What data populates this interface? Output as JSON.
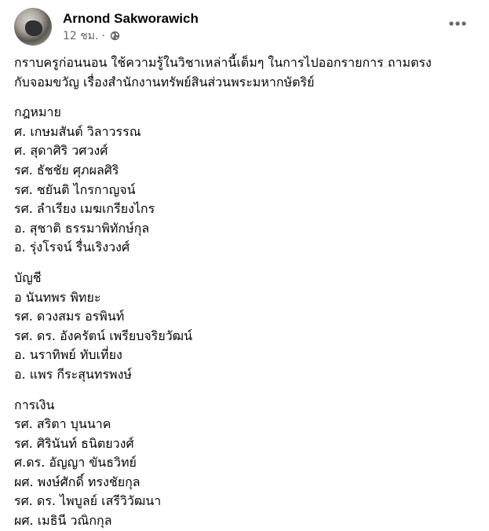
{
  "post": {
    "author": "Arnond Sakworawich",
    "time": "12 ชม.",
    "separator": "·",
    "privacy_icon": "globe-icon",
    "more_icon": "more-dots-icon",
    "intro_lines": [
      "กราบครูก่อนนอน ใช้ความรู้ในวิชาเหล่านี้เต็มๆ ในการไปออกรายการ ถามตรง",
      "กับจอมขวัญ เรื่องสำนักงานทรัพย์สินส่วนพระมหากษัตริย์"
    ],
    "sections": [
      {
        "heading": "กฎหมาย",
        "names": [
          "ศ. เกษมสันต์ วิลาวรรณ",
          "ศ. สุดาศิริ วศวงศ์",
          "รศ. ธัชชัย ศุภผลศิริ",
          "รศ. ชยันติ ไกรกาญจน์",
          "รศ. ลำเรียง เมฆเกรียงไกร",
          "อ. สุชาติ ธรรมาพิทักษ์กุล",
          "อ. รุ่งโรจน์ รื่นเริงวงศ์"
        ]
      },
      {
        "heading": "บัญชี",
        "names": [
          "อ นันทพร พิทยะ",
          "รศ. ดวงสมร อรพินท์",
          "รศ. ดร. อังครัตน์ เพรียบจริยวัฒน์",
          "อ. นราทิพย์ ทับเที่ยง",
          "อ. แพร กีระสุนทรพงษ์"
        ]
      },
      {
        "heading": "การเงิน",
        "names": [
          "รศ. สริตา บุนนาค",
          "รศ. ศิรินันท์ ธนิตยวงศ์",
          "ศ.ดร. อัญญา ขันธวิทย์",
          "ผศ. พงษ์ศักดิ์ ทรงชัยกุล",
          "รศ. ดร. ไพบูลย์ เสรีวิวัฒนา",
          "ผศ. เมธินี วณิกกุล"
        ]
      }
    ]
  }
}
